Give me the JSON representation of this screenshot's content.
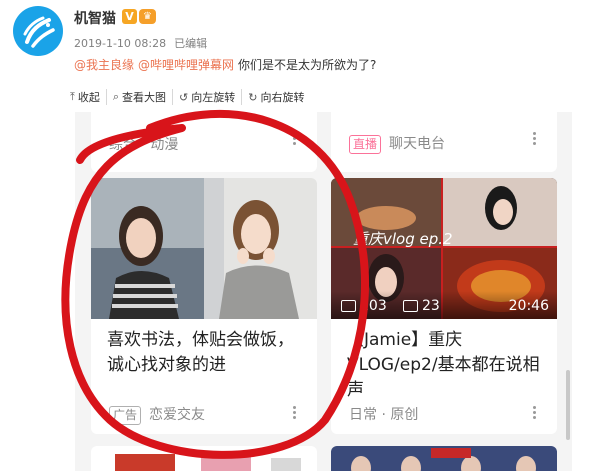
{
  "post": {
    "author": "机智猫",
    "verified_badge": "V",
    "crown_badge": "♛",
    "date": "2019-1-10 08:28",
    "edited": "已编辑",
    "mentions": [
      "@我主良缘",
      "@哔哩哔哩弹幕网"
    ],
    "text": "你们是不是太为所欲为了?"
  },
  "toolbar": {
    "items": [
      {
        "label": "收起",
        "icon": "collapse-icon"
      },
      {
        "label": "查看大图",
        "icon": "zoom-icon"
      },
      {
        "label": "向左旋转",
        "icon": "rotate-left-icon"
      },
      {
        "label": "向右旋转",
        "icon": "rotate-right-icon"
      }
    ]
  },
  "feed": {
    "top_left": {
      "category": "综合 · 动漫"
    },
    "top_right": {
      "live_tag": "直播",
      "category": "聊天电台"
    },
    "ad_card": {
      "title": "喜欢书法，体贴会做饭，诚心找对象的进",
      "tag": "广告",
      "category": "恋爱交友"
    },
    "video_card": {
      "title": "【Jamie】重庆VLOG/ep2/基本都在说相声",
      "overlay_text": "重庆vlog ep.2",
      "plays": "103",
      "comments": "23",
      "duration": "20:46",
      "category": "日常 · 原创"
    }
  },
  "colors": {
    "accent": "#eb7350",
    "bilibili_pink": "#fb7299",
    "annotation_red": "#d8141a",
    "avatar_blue": "#1aa3e8"
  }
}
